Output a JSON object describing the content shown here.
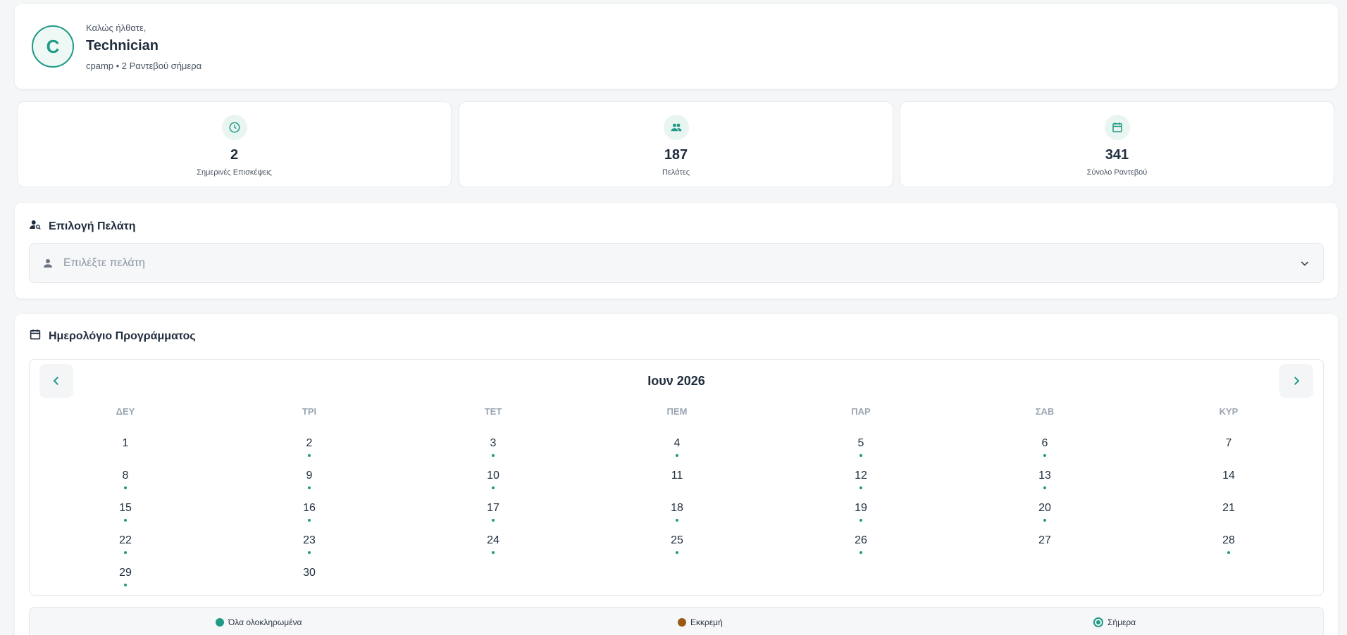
{
  "colors": {
    "accent": "#1f9a86",
    "pending": "#9a5a12",
    "background": "#f4f6f8"
  },
  "header": {
    "avatar_initial": "C",
    "greeting": "Καλώς ήλθατε,",
    "role": "Technician",
    "subtitle": "cpamp • 2 Ραντεβού σήμερα"
  },
  "stats": [
    {
      "icon": "clock-icon",
      "value": "2",
      "label": "Σημερινές Επισκέψεις"
    },
    {
      "icon": "people-icon",
      "value": "187",
      "label": "Πελάτες"
    },
    {
      "icon": "calendar-icon",
      "value": "341",
      "label": "Σύνολο Ραντεβού"
    }
  ],
  "client_select": {
    "title": "Επιλογή Πελάτη",
    "placeholder": "Επιλέξτε πελάτη"
  },
  "calendar": {
    "title": "Ημερολόγιο Προγράμματος",
    "month_label": "Ιουν 2026",
    "weekdays": [
      "ΔΕΥ",
      "ΤΡΙ",
      "ΤΕΤ",
      "ΠΕΜ",
      "ΠΑΡ",
      "ΣΑΒ",
      "ΚΥΡ"
    ],
    "first_weekday_index": 0,
    "days_in_month": 30,
    "days_with_appointments": [
      2,
      3,
      4,
      5,
      6,
      8,
      9,
      10,
      12,
      13,
      15,
      16,
      17,
      18,
      19,
      20,
      22,
      23,
      24,
      25,
      26,
      28,
      29
    ]
  },
  "legend": {
    "completed": "Όλα ολοκληρωμένα",
    "pending": "Εκκρεμή",
    "today": "Σήμερα"
  }
}
